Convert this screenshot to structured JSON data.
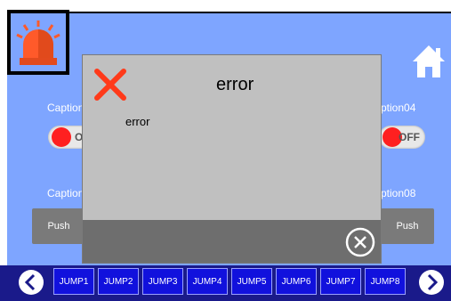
{
  "captions": [
    "Caption",
    "ption04",
    "Caption",
    "ption08"
  ],
  "toggles": {
    "left_label": "O",
    "right_label": "OFF"
  },
  "push_buttons": [
    "Push",
    "Push"
  ],
  "dialog": {
    "title": "error",
    "message": "error"
  },
  "nav": {
    "jumps": [
      "JUMP1",
      "JUMP2",
      "JUMP3",
      "JUMP4",
      "JUMP5",
      "JUMP6",
      "JUMP7",
      "JUMP8"
    ]
  },
  "icons": {
    "alarm": "alarm-light-icon",
    "home": "home-icon",
    "error": "x-icon",
    "close": "close-circle-icon",
    "prev": "chevron-left-icon",
    "next": "chevron-right-icon"
  },
  "colors": {
    "background": "#7ea5ff",
    "nav_bg": "#1a1a8a",
    "nav_button": "#1111dd",
    "dialog": "#c0c0c0",
    "error_x": "#ff3a1a",
    "alarm": "#ff5a2a"
  }
}
